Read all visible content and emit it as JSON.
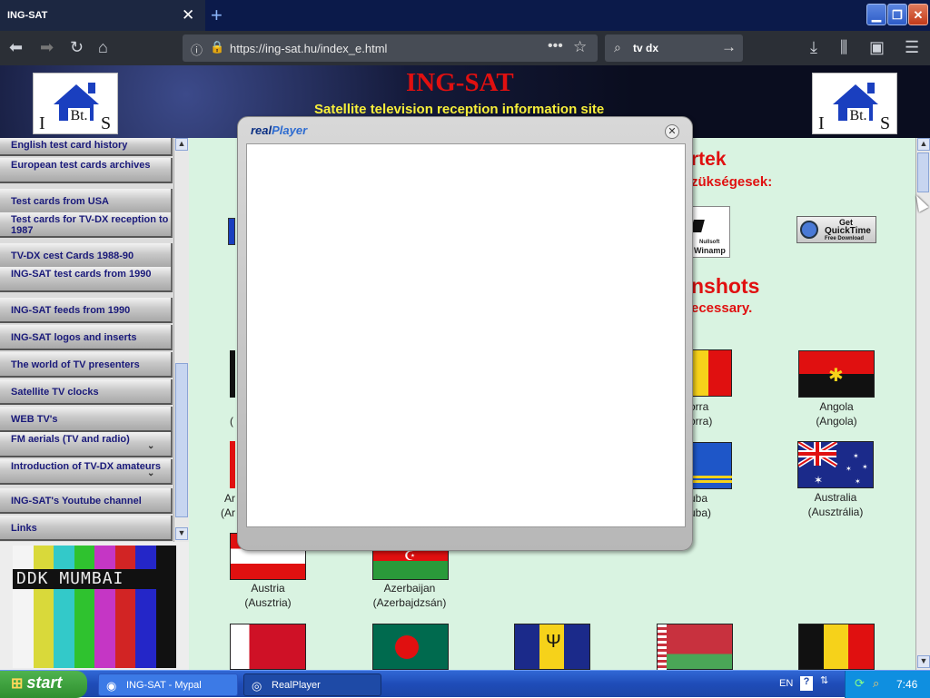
{
  "browser": {
    "tab_title": "ING-SAT",
    "tab_close": "✕",
    "new_tab": "+",
    "url": "https://ing-sat.hu/index_e.html",
    "search_value": "tv dx",
    "controls": {
      "minimize": "▁",
      "maximize": "❐",
      "close": "✕"
    }
  },
  "banner": {
    "title": "ING-SAT",
    "subtitle": "Satellite television reception information site",
    "logo_i": "I",
    "logo_bt": "Bt.",
    "logo_s": "S"
  },
  "sidebar": {
    "items": [
      {
        "label": "English test card history"
      },
      {
        "label": "European test cards archives"
      },
      {
        "label": "Test cards from USA"
      },
      {
        "label": "Test cards for TV-DX reception to 1987"
      },
      {
        "label": "TV-DX cest Cards 1988-90"
      },
      {
        "label": "ING-SAT test cards from 1990"
      },
      {
        "label": "ING-SAT feeds from 1990"
      },
      {
        "label": "ING-SAT logos and inserts"
      },
      {
        "label": "The world of TV presenters"
      },
      {
        "label": "Satellite TV clocks"
      },
      {
        "label": "WEB TV's"
      },
      {
        "label": "FM aerials (TV and radio)",
        "expandable": true
      },
      {
        "label": "Introduction of TV-DX amateurs",
        "expandable": true
      },
      {
        "label": "ING-SAT's Youtube channel"
      },
      {
        "label": "Links"
      }
    ],
    "test_card_label": "DDK MUMBAI"
  },
  "main": {
    "heading1_frag": "rtek",
    "heading1_sub_frag": "zükségesek:",
    "heading2_frag": "nshots",
    "heading2_sub_frag": "ecessary.",
    "quicktime": {
      "line1": "Get",
      "line2": "QuickTime",
      "line3": "Free Download"
    },
    "winamp": {
      "line1": "Nullsoft",
      "line2": "Winamp"
    },
    "flags": [
      {
        "name": "orra",
        "native": "orra)",
        "frag": true
      },
      {
        "name": "Angola",
        "native": "(Angola)"
      },
      {
        "name": "uba",
        "native": "uba)",
        "frag": true
      },
      {
        "name": "Australia",
        "native": "(Ausztrália)"
      },
      {
        "name": "Austria",
        "native": "(Ausztria)"
      },
      {
        "name": "Azerbaijan",
        "native": "(Azerbajdzsán)"
      }
    ],
    "left_frags": [
      "(",
      "Ar",
      "(Ar"
    ]
  },
  "popup": {
    "logo_real": "real",
    "logo_player": "Player",
    "close": "✕"
  },
  "taskbar": {
    "start": "start",
    "tasks": [
      {
        "label": "ING-SAT - Mypal"
      },
      {
        "label": "RealPlayer"
      }
    ],
    "lang": "EN",
    "help": "?",
    "clock": "7:46"
  },
  "colors": {
    "page_bg": "#d9f3e1",
    "title_red": "#e01010",
    "subtitle_yellow": "#f6ee3a",
    "sidebar_text": "#1a1a7a"
  }
}
